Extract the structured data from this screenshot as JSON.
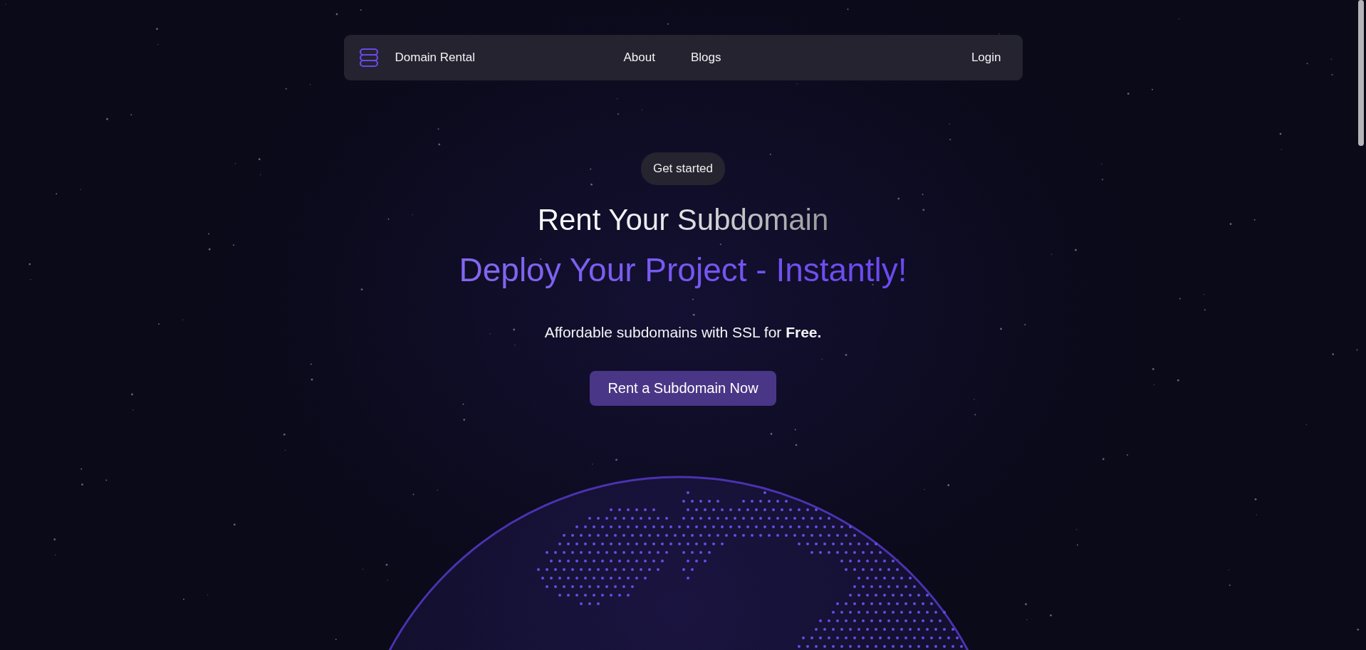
{
  "navbar": {
    "brand": "Domain Rental",
    "links": [
      "About",
      "Blogs"
    ],
    "login": "Login"
  },
  "hero": {
    "badge": "Get started",
    "title": "Rent Your Subdomain",
    "subtitle": "Deploy Your Project - Instantly!",
    "tagline": "Affordable subdomains with SSL for  **Free.**",
    "cta": "Rent a Subdomain Now"
  }
}
